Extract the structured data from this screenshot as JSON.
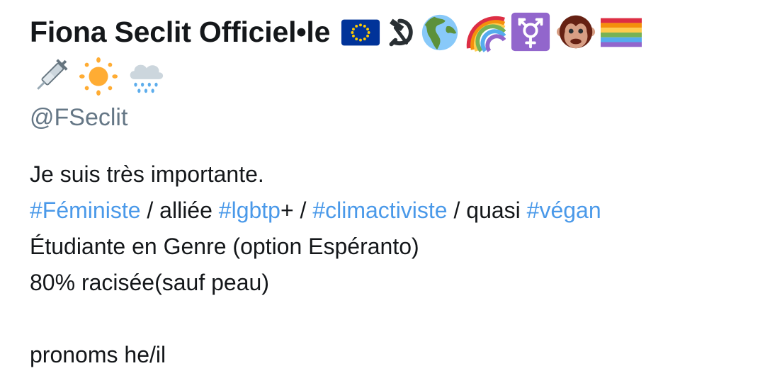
{
  "profile": {
    "display_name": "Fiona Seclit Officiel•le",
    "handle": "@FSeclit",
    "name_emojis": [
      "eu-flag-icon",
      "hammer-sickle-icon",
      "globe-icon",
      "rainbow-icon",
      "transgender-symbol-icon",
      "monkey-face-icon",
      "rainbow-flag-icon"
    ],
    "second_row_emojis": [
      "syringe-icon",
      "sun-icon",
      "cloud-rain-icon"
    ]
  },
  "bio": {
    "line1": "Je suis très importante.",
    "line2": {
      "tag1": "#Féministe",
      "text1": " / alliée ",
      "tag2": "#lgbtp",
      "text2": "+ / ",
      "tag3": "#climactiviste",
      "text3": " / quasi ",
      "tag4": "#végan"
    },
    "line3": "Étudiante en Genre (option Espéranto)",
    "line4": "80% racisée(sauf peau)",
    "line5": "pronoms he/il"
  },
  "colors": {
    "text": "#14171a",
    "secondary": "#657786",
    "link": "#4a99e9"
  }
}
